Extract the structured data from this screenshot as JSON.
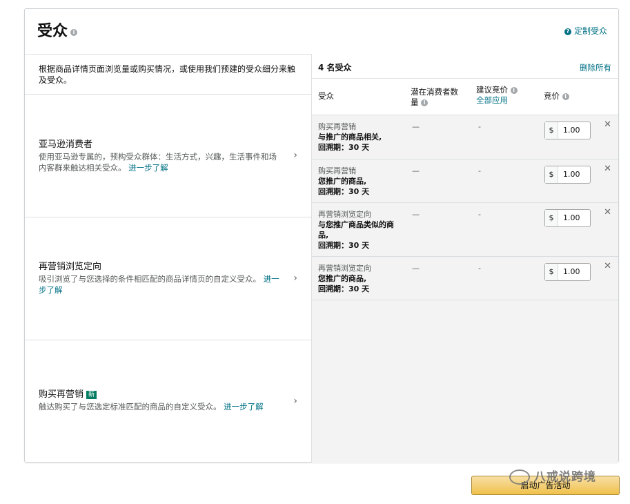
{
  "header": {
    "title": "受众",
    "customize_link": "定制受众"
  },
  "intro_text": "根据商品详情页面浏览量或购买情况，或使用我们预建的受众细分来触及受众。",
  "options": [
    {
      "title": "亚马逊消费者",
      "description": "使用亚马逊专属的，预构受众群体：生活方式，兴趣，生活事件和场内客群来触达相关受众。",
      "link": "进一步了解"
    },
    {
      "title": "再营销浏览定向",
      "description": "吸引浏览了与您选择的条件相匹配的商品详情页的自定义受众。",
      "link": "进一步了解"
    },
    {
      "title": "购买再营销",
      "badge": "新",
      "description": "触达购买了与您选定标准匹配的商品的自定义受众。",
      "link": "进一步了解"
    }
  ],
  "audience_list": {
    "count_label": "4 名受众",
    "remove_all": "删除所有",
    "columns": {
      "audience": "受众",
      "potential": "潜在消费者数量",
      "suggested": "建议竞价",
      "apply_all": "全部应用",
      "bid": "竞价"
    },
    "rows": [
      {
        "type": "购买再营销",
        "desc1": "与推广的商品相关,",
        "desc2": "回溯期：30 天",
        "potential": "—",
        "suggested": "-",
        "currency": "$",
        "bid": "1.00"
      },
      {
        "type": "购买再营销",
        "desc1": "您推广的商品,",
        "desc2": "回溯期：30 天",
        "potential": "—",
        "suggested": "-",
        "currency": "$",
        "bid": "1.00"
      },
      {
        "type": "再营销浏览定向",
        "desc1": "与您推广商品类似的商品,",
        "desc2": "回溯期：30 天",
        "potential": "—",
        "suggested": "-",
        "currency": "$",
        "bid": "1.00"
      },
      {
        "type": "再营销浏览定向",
        "desc1": "您推广的商品,",
        "desc2": "回溯期：30 天",
        "potential": "—",
        "suggested": "-",
        "currency": "$",
        "bid": "1.00"
      }
    ]
  },
  "footer": {
    "launch_button": "启动广告活动"
  },
  "watermark": "八戒说跨境",
  "colors": {
    "link": "#007185",
    "button": "#f0c14b",
    "badge": "#067d62"
  }
}
